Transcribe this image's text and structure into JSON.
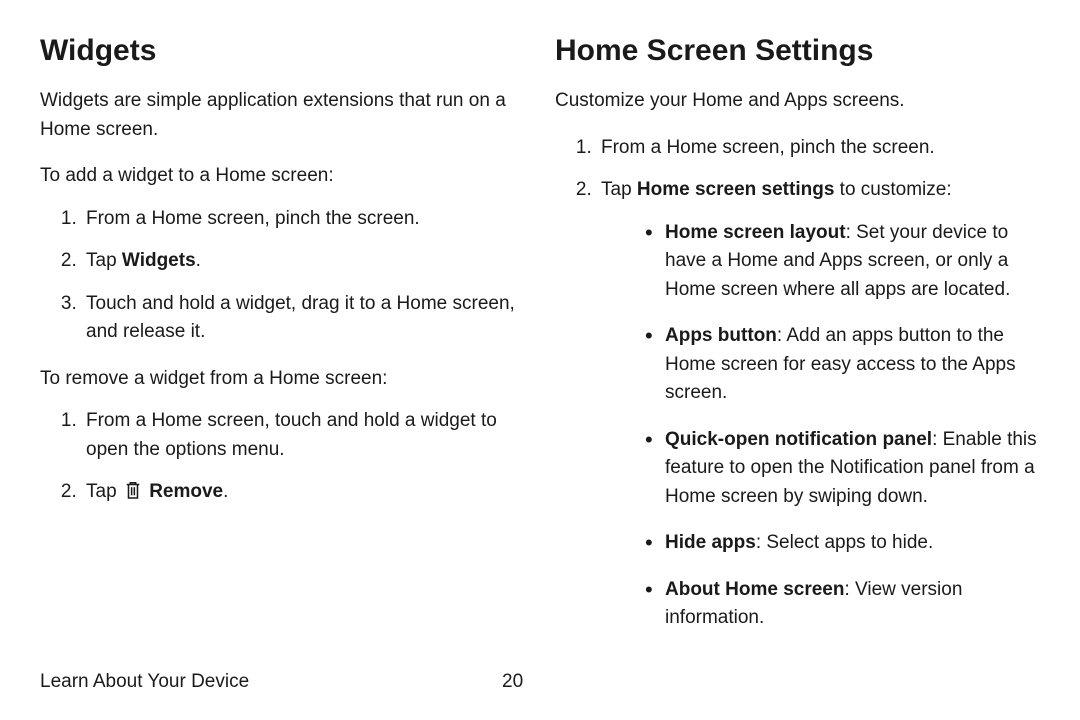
{
  "left": {
    "heading": "Widgets",
    "intro": "Widgets are simple application extensions that run on a Home screen.",
    "add_lead": "To add a widget to a Home screen:",
    "add_steps": {
      "s1": "From a Home screen, pinch the screen.",
      "s2_pre": "Tap ",
      "s2_bold": "Widgets",
      "s2_post": ".",
      "s3": "Touch and hold a widget, drag it to a Home screen, and release it."
    },
    "remove_lead": "To remove a widget from a Home screen:",
    "remove_steps": {
      "s1": "From a Home screen, touch and hold a widget to open the options menu.",
      "s2_pre": "Tap ",
      "s2_icon": "trash-icon",
      "s2_bold": " Remove",
      "s2_post": "."
    }
  },
  "right": {
    "heading": "Home Screen Settings",
    "intro": "Customize your Home and Apps screens.",
    "s1": "From a Home screen, pinch the screen.",
    "s2_pre": "Tap ",
    "s2_bold": "Home screen settings",
    "s2_post": " to customize:",
    "bullets": {
      "b1_bold": "Home screen layout",
      "b1_text": ": Set your device to have a Home and Apps screen, or only a Home screen where all apps are located.",
      "b2_bold": "Apps button",
      "b2_text": ": Add an apps button to the Home screen for easy access to the Apps screen.",
      "b3_bold": "Quick-open notification panel",
      "b3_text": ": Enable this feature to open the Notification panel from a Home screen by swiping down.",
      "b4_bold": "Hide apps",
      "b4_text": ": Select apps to hide.",
      "b5_bold": "About Home screen",
      "b5_text": ": View version information."
    }
  },
  "footer": {
    "section": "Learn About Your Device",
    "page": "20"
  }
}
